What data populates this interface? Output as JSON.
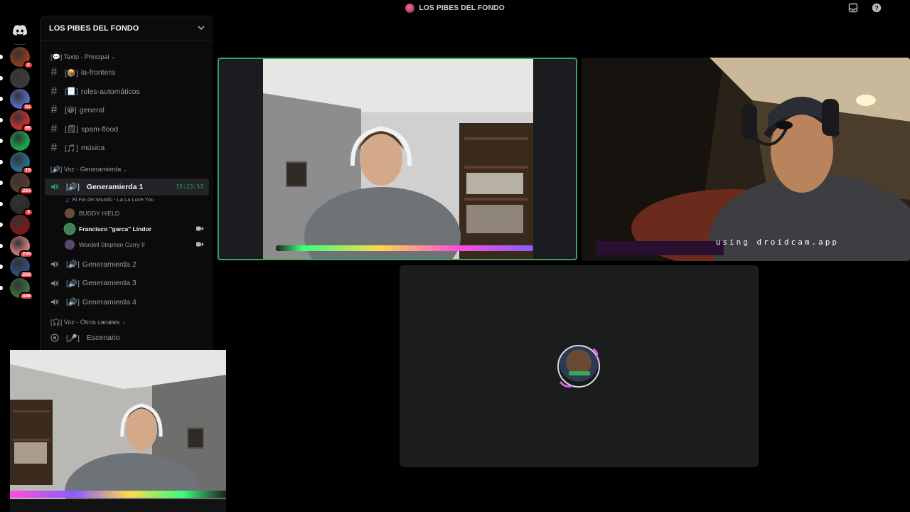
{
  "window": {
    "title": "LOS PIBES DEL FONDO"
  },
  "rail": {
    "servers": [
      {
        "name": "server-1",
        "badge": "2",
        "color": "#8a3b1a"
      },
      {
        "name": "server-2",
        "badge": "",
        "color": "#3a3a3a"
      },
      {
        "name": "server-3",
        "badge": "51",
        "color": "#5468c0"
      },
      {
        "name": "server-4",
        "badge": "95",
        "color": "#c43030"
      },
      {
        "name": "server-5",
        "badge": "",
        "color": "#1aa34a"
      },
      {
        "name": "server-6",
        "badge": "15",
        "color": "#2b6b8f"
      },
      {
        "name": "server-7",
        "badge": "293",
        "color": "#5a3a2a"
      },
      {
        "name": "server-8",
        "badge": "3",
        "color": "#2a2a2a"
      },
      {
        "name": "server-9",
        "badge": "",
        "color": "#7a1a1a"
      },
      {
        "name": "server-10",
        "badge": "235",
        "color": "#c77a7a"
      },
      {
        "name": "server-11",
        "badge": "268",
        "color": "#2d4d7a"
      },
      {
        "name": "server-12",
        "badge": "446",
        "color": "#3c6a3c"
      }
    ]
  },
  "sidebar": {
    "server_name": "LOS PIBES DEL FONDO",
    "categories": {
      "text": "[💬] Texto - Principal",
      "voice_main": "[🔊] Voz - Generamierda",
      "voice_other": "[🎧] Voz - Otros canales"
    },
    "text_channels": [
      {
        "label": "la-frontera",
        "emoji": "[📦]"
      },
      {
        "label": "roles-automáticos",
        "emoji": "[📃]"
      },
      {
        "label": "general",
        "emoji": "[😀]"
      },
      {
        "label": "spam-flood",
        "emoji": "[🗒]"
      },
      {
        "label": "música",
        "emoji": "[🎵]"
      }
    ],
    "active_voice": {
      "label": "Generamierda 1",
      "prefix": "[🔊]",
      "timer": "15:23:53",
      "activity": "El Fin del Mundo - La La Love You"
    },
    "members": [
      {
        "name": "BUDDY HIELD",
        "bright": false
      },
      {
        "name": "Francisco \"garca\" Lindor",
        "bright": true
      },
      {
        "name": "Wardell Stephen Curry II",
        "bright": false
      }
    ],
    "voice_channels": [
      {
        "label": "Generamierda 2",
        "prefix": "[🔊]"
      },
      {
        "label": "Generamierda 3",
        "prefix": "[🔊]"
      },
      {
        "label": "Generamierda 4",
        "prefix": "[🔊]"
      }
    ],
    "stage": {
      "label": "Escenario",
      "prefix": "[🎤]"
    }
  },
  "stream": {
    "overlay_text": "using droidcam.app"
  },
  "colors": {
    "speaking": "#3ba55c",
    "badge": "#f23f43"
  }
}
